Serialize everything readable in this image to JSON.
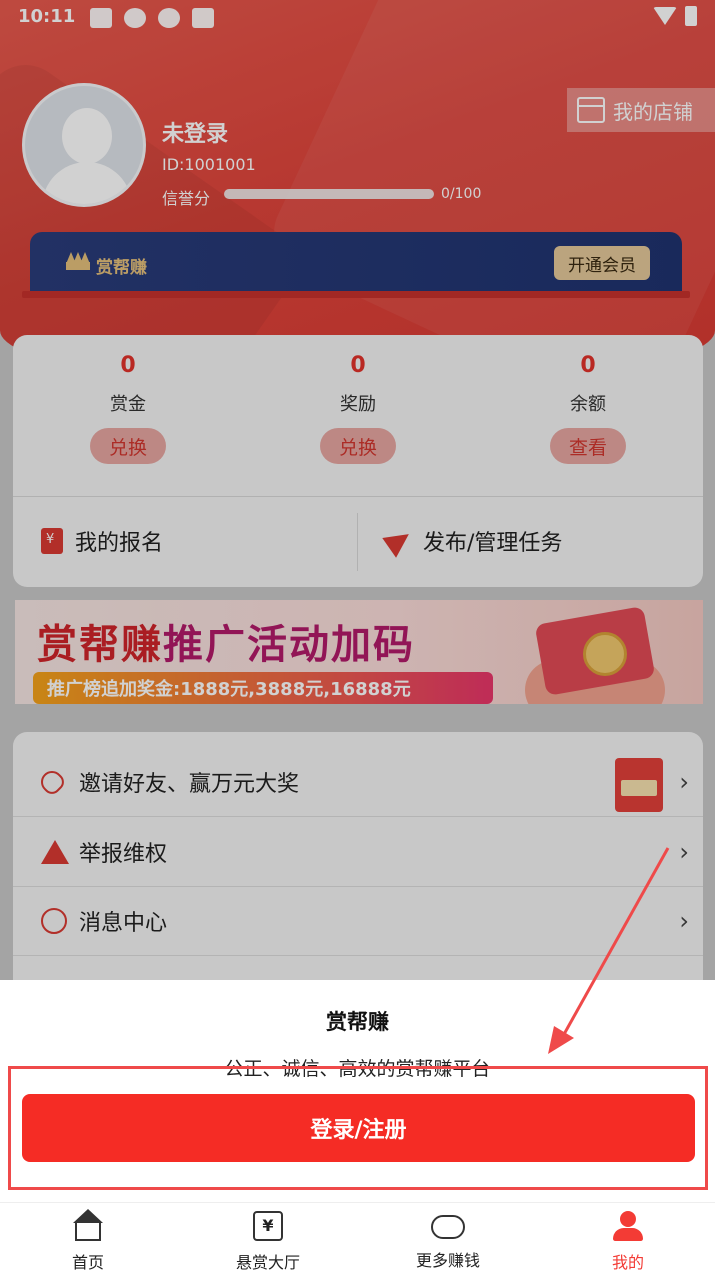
{
  "status_bar": {
    "time": "10:11"
  },
  "profile": {
    "name": "未登录",
    "id": "ID:1001001",
    "credit_label": "信誉分",
    "credit_value": "0/100",
    "credit_progress": 0,
    "shop_label": "我的店铺"
  },
  "vip": {
    "title": "赏帮赚",
    "button": "开通会员"
  },
  "stats": [
    {
      "value": "0",
      "label": "赏金",
      "action": "兑换"
    },
    {
      "value": "0",
      "label": "奖励",
      "action": "兑换"
    },
    {
      "value": "0",
      "label": "余额",
      "action": "查看"
    }
  ],
  "actions": {
    "signup": "我的报名",
    "publish": "发布/管理任务"
  },
  "banner": {
    "title_a": "赏帮赚",
    "title_b": "推广活动加码",
    "bar_text": "推广榜追加奖金:1888元,3888元,16888元"
  },
  "menu": [
    {
      "label": "邀请好友、赢万元大奖",
      "icon": "heart-icon"
    },
    {
      "label": "举报维权",
      "icon": "warning-icon"
    },
    {
      "label": "消息中心",
      "icon": "message-icon"
    }
  ],
  "sheet": {
    "title": "赏帮赚",
    "subtitle": "公正、诚信、高效的赏帮赚平台",
    "login_button": "登录/注册"
  },
  "tabs": [
    {
      "label": "首页",
      "icon": "home-icon"
    },
    {
      "label": "悬赏大厅",
      "icon": "reward-hall-icon"
    },
    {
      "label": "更多赚钱",
      "icon": "gamepad-icon"
    },
    {
      "label": "我的",
      "icon": "profile-icon"
    }
  ],
  "colors": {
    "accent": "#f52c25",
    "vip_bg": "#2a3c7a",
    "vip_gold": "#e4c07c"
  }
}
